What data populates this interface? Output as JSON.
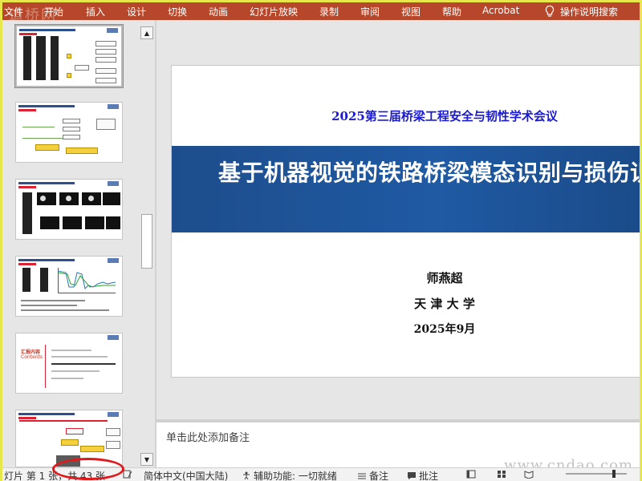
{
  "ribbon": {
    "tabs": [
      "文件",
      "开始",
      "插入",
      "设计",
      "切换",
      "动画",
      "幻灯片放映",
      "录制",
      "审阅",
      "视图",
      "帮助",
      "Acrobat"
    ],
    "tell_me": "操作说明搜索",
    "watermark": "道桥网",
    "background_color": "#b7472a"
  },
  "thumbnails": {
    "slide5_title": "汇报内容",
    "slide5_subtitle": "Contents"
  },
  "slide": {
    "conference": "2025第三届桥梁工程安全与韧性学术会议",
    "title": "基于机器视觉的铁路桥梁模态识别与损伤识",
    "presenter": "师燕超",
    "affiliation": "天 津 大 学",
    "date": "2025年9月",
    "banner_color": "#1f5aa3",
    "conference_color": "#1a1ad0"
  },
  "notes": {
    "placeholder": "单击此处添加备注",
    "watermark": "www.cndao.com"
  },
  "statusbar": {
    "slide_info": "灯片 第 1 张，共 43 张",
    "language": "简体中文(中国大陆)",
    "accessibility": "辅助功能: 一切就绪",
    "notes_btn": "备注",
    "comments_btn": "批注"
  }
}
